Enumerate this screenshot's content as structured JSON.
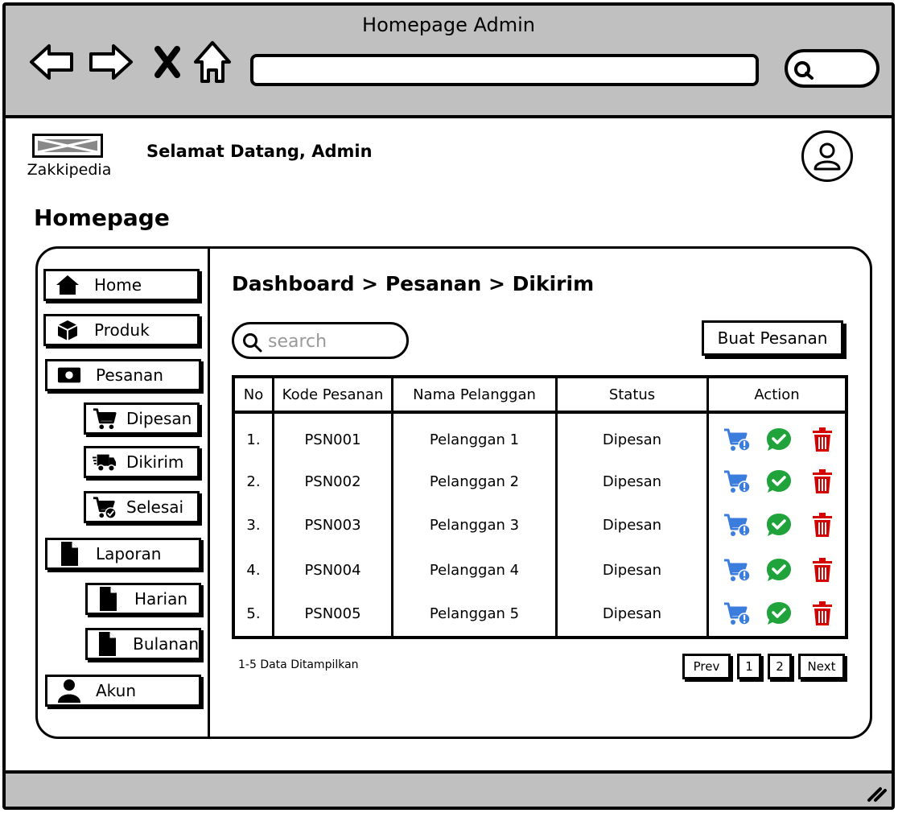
{
  "window": {
    "title": "Homepage Admin"
  },
  "header": {
    "app_name": "Zakkipedia",
    "welcome": "Selamat Datang, Admin",
    "page_title": "Homepage"
  },
  "sidebar": {
    "items": [
      {
        "label": "Home",
        "icon": "home-icon"
      },
      {
        "label": "Produk",
        "icon": "box-icon"
      },
      {
        "label": "Pesanan",
        "icon": "money-icon"
      },
      {
        "label": "Dipesan",
        "icon": "cart-icon"
      },
      {
        "label": "Dikirim",
        "icon": "delivery-truck-icon"
      },
      {
        "label": "Selesai",
        "icon": "cart-check-icon"
      },
      {
        "label": "Laporan",
        "icon": "document-icon"
      },
      {
        "label": "Harian",
        "icon": "document-icon"
      },
      {
        "label": "Bulanan",
        "icon": "document-icon"
      },
      {
        "label": "Akun",
        "icon": "user-icon"
      }
    ]
  },
  "main": {
    "breadcrumb": "Dashboard > Pesanan > Dikirim",
    "search_placeholder": "search",
    "create_button": "Buat Pesanan",
    "table": {
      "headers": [
        "No",
        "Kode Pesanan",
        "Nama Pelanggan",
        "Status",
        "Action"
      ],
      "rows": [
        {
          "no": "1.",
          "code": "PSN001",
          "customer": "Pelanggan 1",
          "status": "Dipesan"
        },
        {
          "no": "2.",
          "code": "PSN002",
          "customer": "Pelanggan 2",
          "status": "Dipesan"
        },
        {
          "no": "3.",
          "code": "PSN003",
          "customer": "Pelanggan 3",
          "status": "Dipesan"
        },
        {
          "no": "4.",
          "code": "PSN004",
          "customer": "Pelanggan 4",
          "status": "Dipesan"
        },
        {
          "no": "5.",
          "code": "PSN005",
          "customer": "Pelanggan 5",
          "status": "Dipesan"
        }
      ]
    },
    "data_info": "1-5 Data Ditampilkan",
    "pagination": {
      "prev": "Prev",
      "pages": [
        "1",
        "2"
      ],
      "next": "Next"
    }
  },
  "colors": {
    "detail": "#3b7ddd",
    "confirm": "#1fa33a",
    "delete": "#d40000",
    "frame": "#c0c0c0"
  }
}
